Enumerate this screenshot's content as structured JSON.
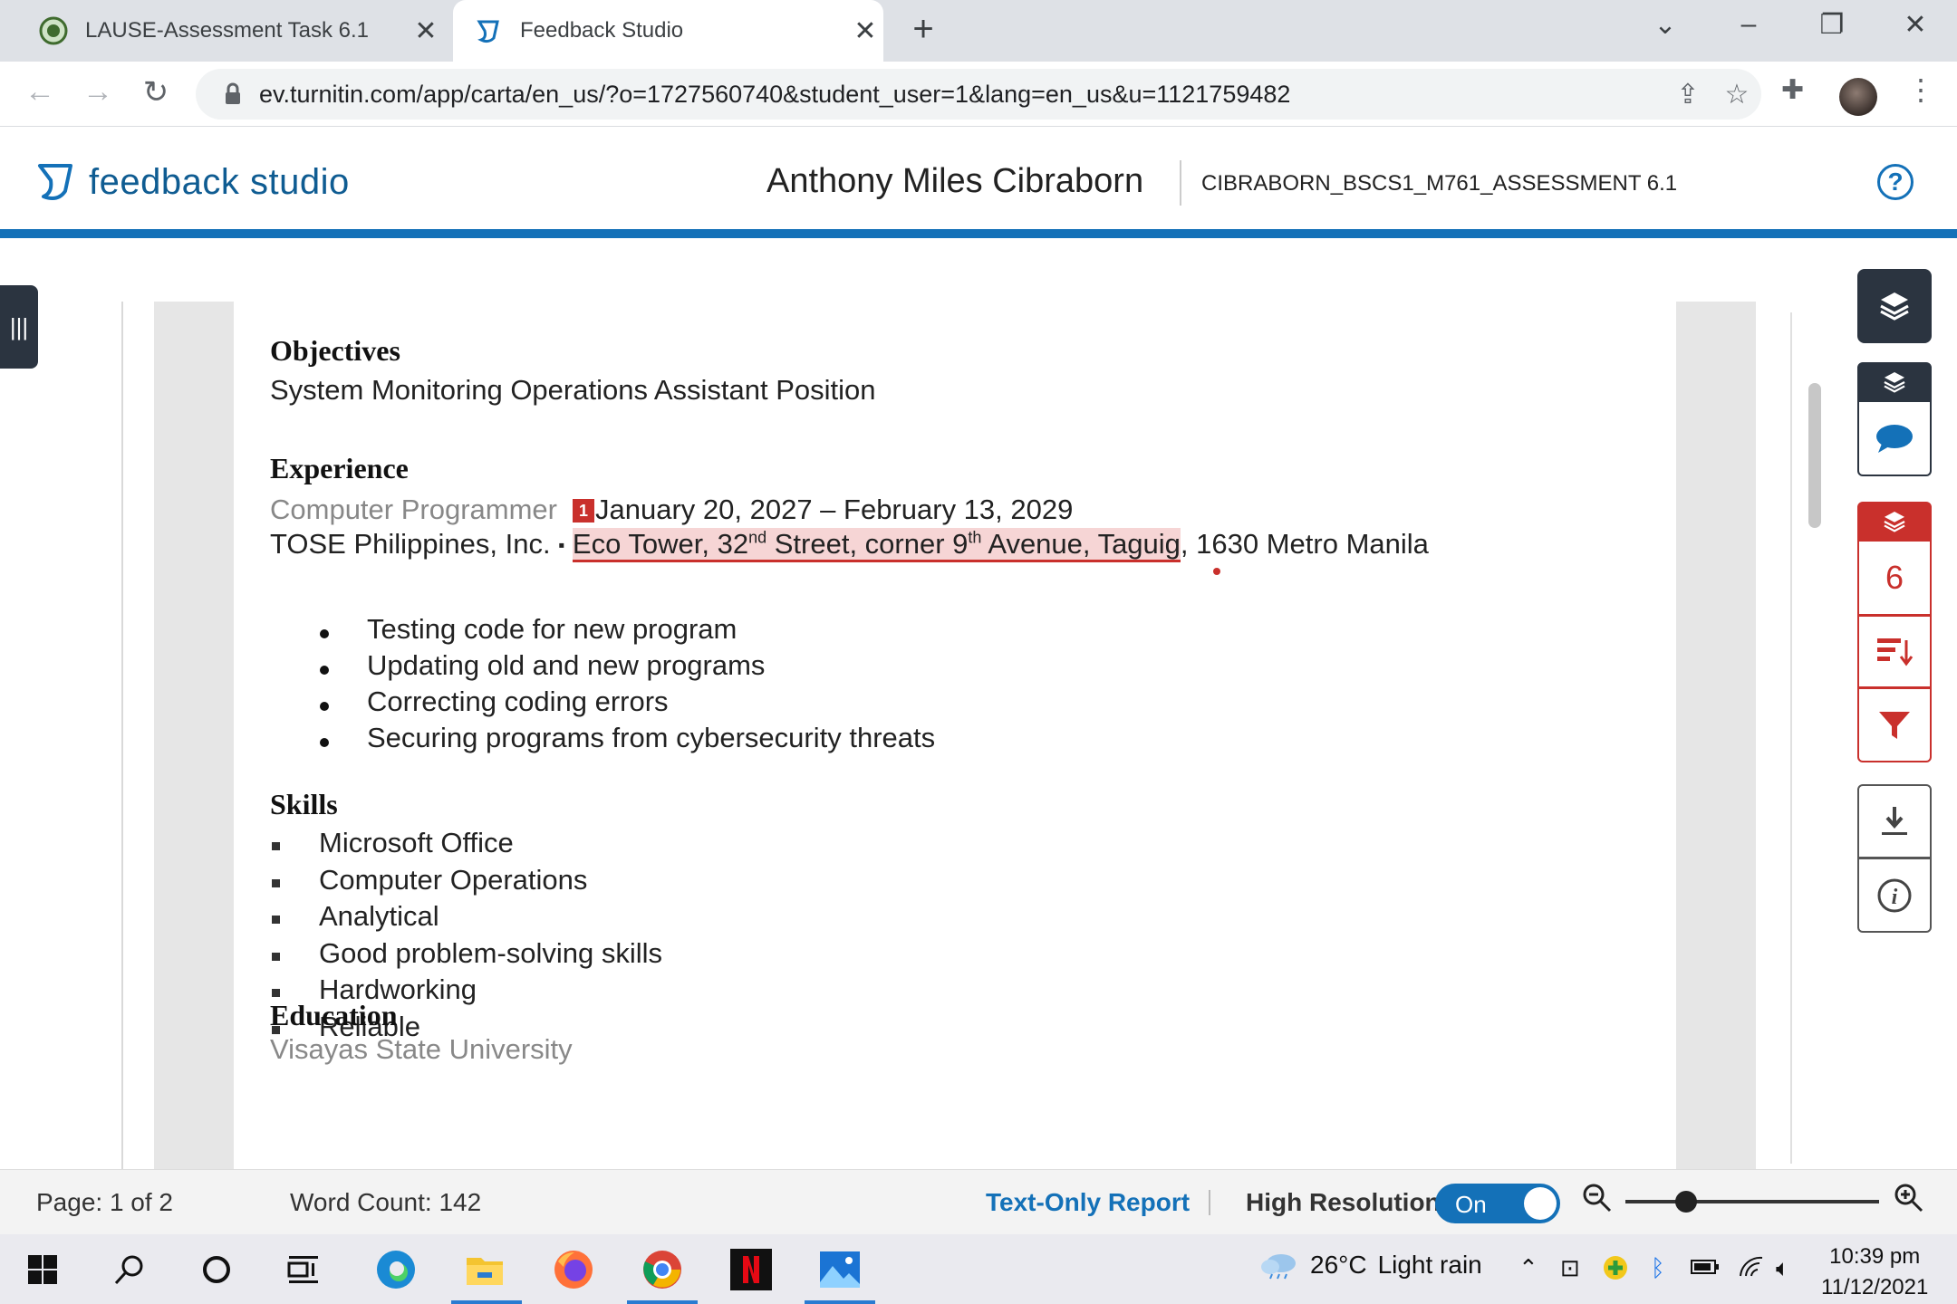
{
  "browser": {
    "tabs": [
      {
        "label": "LAUSE-Assessment Task 6.1",
        "active": false
      },
      {
        "label": "Feedback Studio",
        "active": true
      }
    ],
    "url": "ev.turnitin.com/app/carta/en_us/?o=1727560740&student_user=1&lang=en_us&u=1121759482",
    "icons": [
      "back-icon",
      "forward-icon",
      "reload-icon",
      "lock-icon",
      "share-icon",
      "star-icon",
      "extensions-icon",
      "profile-avatar",
      "menu-icon"
    ]
  },
  "app": {
    "logo_text": "feedback studio",
    "student_name": "Anthony Miles Cibraborn",
    "document_title": "CIBRABORN_BSCS1_M761_ASSESSMENT 6.1",
    "help_label": "?"
  },
  "document": {
    "objectives": {
      "heading": "Objectives",
      "text": "System Monitoring Operations Assistant Position"
    },
    "experience": {
      "heading": "Experience",
      "role": "Computer Programmer",
      "match_number": "1",
      "dates": "January 20, 2027 – February 13, 2029",
      "company": "TOSE Philippines, Inc.",
      "sep": "▪",
      "addr_part1": "Eco Tower, 32",
      "addr_sup1": "nd",
      "addr_part2": " Street, corner 9",
      "addr_sup2": "th",
      "addr_part3": " Avenue, Taguig",
      "addr_rest": ", 1630 Metro Manila",
      "duties": [
        "Testing code for new program",
        "Updating old and new programs",
        "Correcting coding errors",
        "Securing programs from cybersecurity threats"
      ]
    },
    "skills": {
      "heading": "Skills",
      "items": [
        "Microsoft Office",
        "Computer Operations",
        "Analytical",
        "Good problem-solving skills",
        "Hardworking",
        "Reliable"
      ]
    },
    "education": {
      "heading": "Education",
      "school": "Visayas State University"
    }
  },
  "panel": {
    "similarity_score": "6",
    "colors": {
      "feedback": "#2b3440",
      "similarity": "#c9302c",
      "accent": "#1471b8"
    }
  },
  "status": {
    "page": "Page: 1 of 2",
    "word_count": "Word Count: 142",
    "text_only_report": "Text-Only Report",
    "high_resolution_label": "High Resolution",
    "toggle_state": "On",
    "zoom_level_fraction": 0.24
  },
  "taskbar": {
    "weather_temp": "26°C",
    "weather_desc": "Light rain",
    "time": "10:39 pm",
    "date": "11/12/2021"
  }
}
